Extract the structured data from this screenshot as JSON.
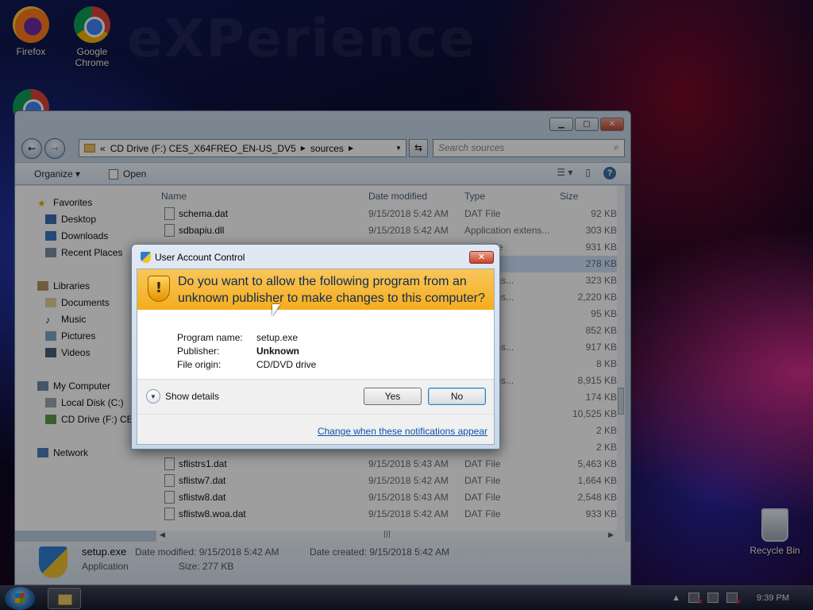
{
  "desktop": {
    "watermark": "eXPerience",
    "icons": [
      {
        "label": "Firefox"
      },
      {
        "label": "Google Chrome"
      },
      {
        "label": "Recycle Bin"
      }
    ]
  },
  "explorer": {
    "address": {
      "chevrons": "«",
      "drive": "CD Drive (F:) CES_X64FREO_EN-US_DV5",
      "folder": "sources"
    },
    "search_placeholder": "Search sources",
    "commands": {
      "organize": "Organize ▾",
      "open": "Open"
    },
    "nav": {
      "favorites": "Favorites",
      "desktop": "Desktop",
      "downloads": "Downloads",
      "recent": "Recent Places",
      "libraries": "Libraries",
      "documents": "Documents",
      "music": "Music",
      "pictures": "Pictures",
      "videos": "Videos",
      "computer": "My Computer",
      "local_disk": "Local Disk (C:)",
      "cd_drive": "CD Drive (F:) CES",
      "network": "Network"
    },
    "columns": {
      "name": "Name",
      "date": "Date modified",
      "type": "Type",
      "size": "Size"
    },
    "files": [
      {
        "name": "schema.dat",
        "date": "9/15/2018 5:42 AM",
        "type": "DAT File",
        "size": "92 KB"
      },
      {
        "name": "sdbapiu.dll",
        "date": "9/15/2018 5:42 AM",
        "type": "Application extens...",
        "size": "303 KB"
      },
      {
        "name": "",
        "date": "",
        "type": "e font file",
        "size": "931 KB"
      },
      {
        "name": "",
        "date": "",
        "type": "on",
        "size": "278 KB"
      },
      {
        "name": "",
        "date": "",
        "type": "on extens...",
        "size": "323 KB"
      },
      {
        "name": "",
        "date": "",
        "type": "on extens...",
        "size": "2,220 KB"
      },
      {
        "name": "",
        "date": "",
        "type": "on",
        "size": "95 KB"
      },
      {
        "name": "",
        "date": "",
        "type": "on",
        "size": "852 KB"
      },
      {
        "name": "",
        "date": "",
        "type": "on extens...",
        "size": "917 KB"
      },
      {
        "name": "",
        "date": "",
        "type": "",
        "size": "8 KB"
      },
      {
        "name": "",
        "date": "",
        "type": "on extens...",
        "size": "8,915 KB"
      },
      {
        "name": "",
        "date": "",
        "type": "on",
        "size": "174 KB"
      },
      {
        "name": "",
        "date": "",
        "type": "on",
        "size": "10,525 KB"
      },
      {
        "name": "",
        "date": "",
        "type": "",
        "size": "2 KB"
      },
      {
        "name": "",
        "date": "",
        "type": "",
        "size": "2 KB"
      },
      {
        "name": "sflistrs1.dat",
        "date": "9/15/2018 5:43 AM",
        "type": "DAT File",
        "size": "5,463 KB"
      },
      {
        "name": "sflistw7.dat",
        "date": "9/15/2018 5:42 AM",
        "type": "DAT File",
        "size": "1,664 KB"
      },
      {
        "name": "sflistw8.dat",
        "date": "9/15/2018 5:43 AM",
        "type": "DAT File",
        "size": "2,548 KB"
      },
      {
        "name": "sflistw8.woa.dat",
        "date": "9/15/2018 5:42 AM",
        "type": "DAT File",
        "size": "933 KB"
      }
    ],
    "details": {
      "name": "setup.exe",
      "kind": "Application",
      "modified": "Date modified: 9/15/2018 5:42 AM",
      "created": "Date created: 9/15/2018 5:42 AM",
      "size": "Size:  277 KB"
    }
  },
  "uac": {
    "title": "User Account Control",
    "question": "Do you want to allow the following program from an unknown publisher to make changes to this computer?",
    "program_label": "Program name:",
    "program_value": "setup.exe",
    "publisher_label": "Publisher:",
    "publisher_value": "Unknown",
    "origin_label": "File origin:",
    "origin_value": "CD/DVD drive",
    "show_details": "Show details",
    "yes": "Yes",
    "no": "No",
    "link": "Change when these notifications appear"
  },
  "taskbar": {
    "time": "9:39 PM"
  }
}
